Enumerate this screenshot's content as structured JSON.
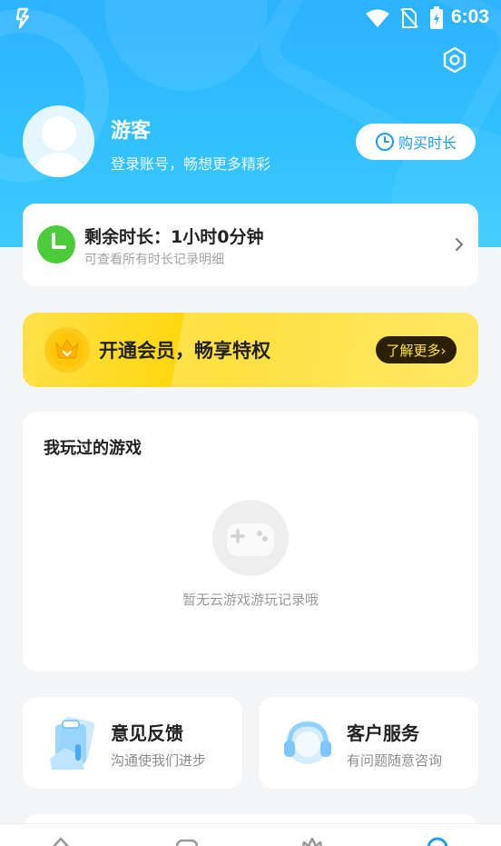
{
  "status_bar": {
    "time": "6:03"
  },
  "profile": {
    "name": "游客",
    "subtitle": "登录账号，畅想更多精彩",
    "buy_button_label": "购买时长"
  },
  "time_card": {
    "title": "剩余时长：1小时0分钟",
    "desc": "可查看所有时长记录明细"
  },
  "vip_banner": {
    "text": "开通会员，畅享特权",
    "more_label": "了解更多›"
  },
  "games": {
    "title": "我玩过的游戏",
    "empty_text": "暂无云游戏游玩记录哦"
  },
  "services": [
    {
      "title": "意见反馈",
      "desc": "沟通使我们进步"
    },
    {
      "title": "客户服务",
      "desc": "有问题随意咨询"
    }
  ],
  "bottom_nav": {
    "items": [
      "home-icon",
      "controller-icon",
      "crown-icon",
      "profile-icon"
    ],
    "active_index": 3
  },
  "colors": {
    "header_blue": "#2cb2ff",
    "accent_blue": "#1e9cf0",
    "vip_yellow": "#ffd400",
    "clock_green": "#4ccc3a"
  }
}
